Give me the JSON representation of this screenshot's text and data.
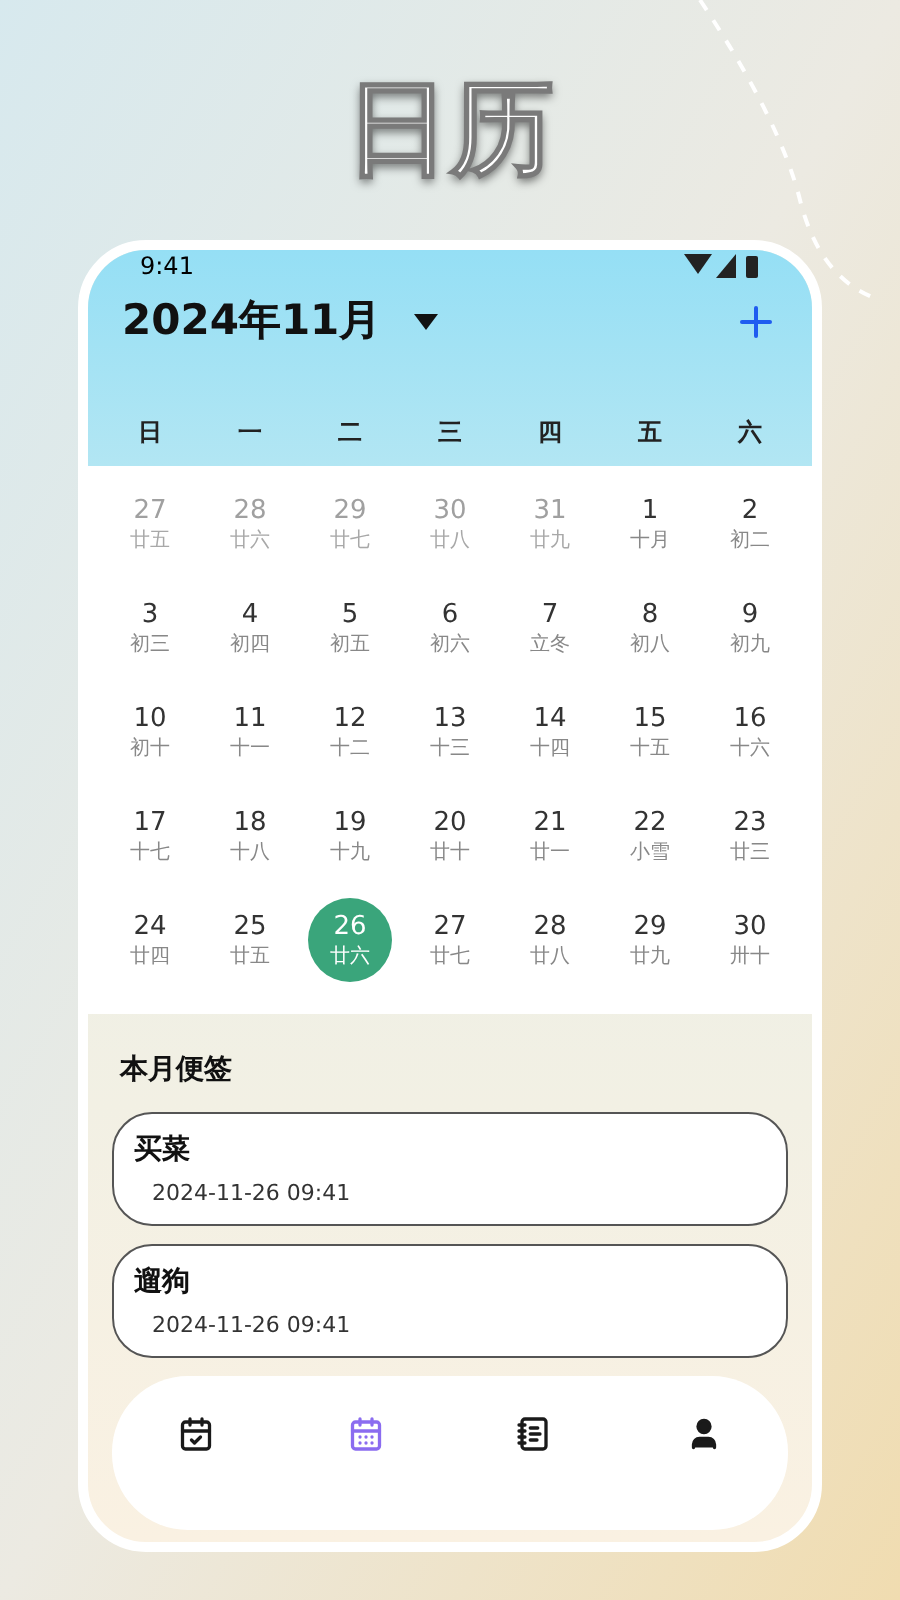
{
  "headline": "日历",
  "status_bar": {
    "time": "9:41"
  },
  "header": {
    "month": "2024年11月"
  },
  "weekdays": [
    "日",
    "一",
    "二",
    "三",
    "四",
    "五",
    "六"
  ],
  "days": [
    {
      "day": "27",
      "lunar": "廿五",
      "faded": true,
      "selected": false
    },
    {
      "day": "28",
      "lunar": "廿六",
      "faded": true,
      "selected": false
    },
    {
      "day": "29",
      "lunar": "廿七",
      "faded": true,
      "selected": false
    },
    {
      "day": "30",
      "lunar": "廿八",
      "faded": true,
      "selected": false
    },
    {
      "day": "31",
      "lunar": "廿九",
      "faded": true,
      "selected": false
    },
    {
      "day": "1",
      "lunar": "十月",
      "faded": false,
      "selected": false
    },
    {
      "day": "2",
      "lunar": "初二",
      "faded": false,
      "selected": false
    },
    {
      "day": "3",
      "lunar": "初三",
      "faded": false,
      "selected": false
    },
    {
      "day": "4",
      "lunar": "初四",
      "faded": false,
      "selected": false
    },
    {
      "day": "5",
      "lunar": "初五",
      "faded": false,
      "selected": false
    },
    {
      "day": "6",
      "lunar": "初六",
      "faded": false,
      "selected": false
    },
    {
      "day": "7",
      "lunar": "立冬",
      "faded": false,
      "selected": false
    },
    {
      "day": "8",
      "lunar": "初八",
      "faded": false,
      "selected": false
    },
    {
      "day": "9",
      "lunar": "初九",
      "faded": false,
      "selected": false
    },
    {
      "day": "10",
      "lunar": "初十",
      "faded": false,
      "selected": false
    },
    {
      "day": "11",
      "lunar": "十一",
      "faded": false,
      "selected": false
    },
    {
      "day": "12",
      "lunar": "十二",
      "faded": false,
      "selected": false
    },
    {
      "day": "13",
      "lunar": "十三",
      "faded": false,
      "selected": false
    },
    {
      "day": "14",
      "lunar": "十四",
      "faded": false,
      "selected": false
    },
    {
      "day": "15",
      "lunar": "十五",
      "faded": false,
      "selected": false
    },
    {
      "day": "16",
      "lunar": "十六",
      "faded": false,
      "selected": false
    },
    {
      "day": "17",
      "lunar": "十七",
      "faded": false,
      "selected": false
    },
    {
      "day": "18",
      "lunar": "十八",
      "faded": false,
      "selected": false
    },
    {
      "day": "19",
      "lunar": "十九",
      "faded": false,
      "selected": false
    },
    {
      "day": "20",
      "lunar": "廿十",
      "faded": false,
      "selected": false
    },
    {
      "day": "21",
      "lunar": "廿一",
      "faded": false,
      "selected": false
    },
    {
      "day": "22",
      "lunar": "小雪",
      "faded": false,
      "selected": false
    },
    {
      "day": "23",
      "lunar": "廿三",
      "faded": false,
      "selected": false
    },
    {
      "day": "24",
      "lunar": "廿四",
      "faded": false,
      "selected": false
    },
    {
      "day": "25",
      "lunar": "廿五",
      "faded": false,
      "selected": false
    },
    {
      "day": "26",
      "lunar": "廿六",
      "faded": false,
      "selected": true
    },
    {
      "day": "27",
      "lunar": "廿七",
      "faded": false,
      "selected": false
    },
    {
      "day": "28",
      "lunar": "廿八",
      "faded": false,
      "selected": false
    },
    {
      "day": "29",
      "lunar": "廿九",
      "faded": false,
      "selected": false
    },
    {
      "day": "30",
      "lunar": "卅十",
      "faded": false,
      "selected": false
    }
  ],
  "notes": {
    "title": "本月便签",
    "items": [
      {
        "title": "买菜",
        "time": "2024-11-26 09:41"
      },
      {
        "title": "遛狗",
        "time": "2024-11-26 09:41"
      }
    ]
  },
  "bottom_nav": [
    {
      "kind": "tasks",
      "selected": false
    },
    {
      "kind": "calendar",
      "selected": true
    },
    {
      "kind": "notebook",
      "selected": false
    },
    {
      "kind": "profile",
      "selected": false
    }
  ]
}
